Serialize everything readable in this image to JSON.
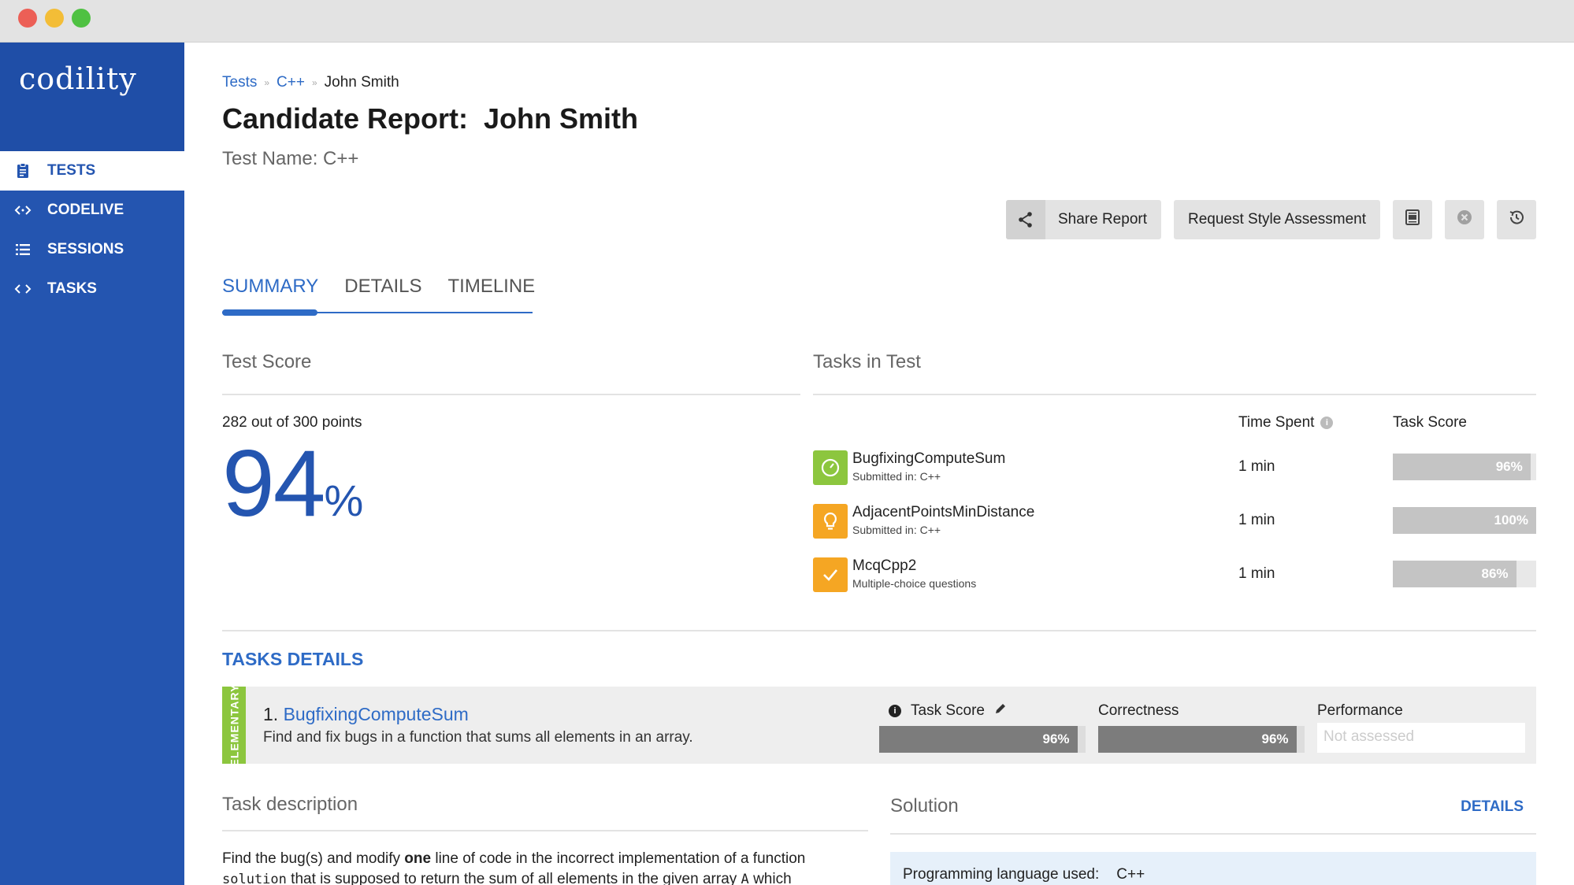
{
  "window": {
    "controls": [
      "close",
      "minimize",
      "maximize"
    ]
  },
  "sidebar": {
    "logo": "codility",
    "items": [
      {
        "label": "TESTS",
        "icon": "clipboard-icon",
        "active": true
      },
      {
        "label": "CODELIVE",
        "icon": "code-brackets-icon",
        "active": false
      },
      {
        "label": "SESSIONS",
        "icon": "list-icon",
        "active": false
      },
      {
        "label": "TASKS",
        "icon": "code-brackets-icon",
        "active": false
      }
    ]
  },
  "breadcrumb": {
    "items": [
      "Tests",
      "C++",
      "John Smith"
    ],
    "separator": "»"
  },
  "page": {
    "title": "Candidate Report:  John Smith",
    "subtitle": "Test Name: C++"
  },
  "toolbar": {
    "share_label": "Share Report",
    "style_label": "Request Style Assessment",
    "icons": [
      "share-icon",
      "pdf-icon",
      "cancel-icon",
      "history-icon"
    ]
  },
  "tabs": [
    {
      "label": "SUMMARY",
      "active": true
    },
    {
      "label": "DETAILS",
      "active": false
    },
    {
      "label": "TIMELINE",
      "active": false
    }
  ],
  "test_score": {
    "heading": "Test Score",
    "points": "282 out of 300 points",
    "value": "94",
    "unit": "%"
  },
  "tasks_in_test": {
    "heading": "Tasks in Test",
    "col_time": "Time Spent",
    "col_score": "Task Score",
    "tasks": [
      {
        "name": "BugfixingComputeSum",
        "sub": "Submitted in: C++",
        "time": "1 min",
        "score": 96,
        "score_label": "96%",
        "icon": "timer-icon",
        "icon_color": "#8cc63e"
      },
      {
        "name": "AdjacentPointsMinDistance",
        "sub": "Submitted in: C++",
        "time": "1 min",
        "score": 100,
        "score_label": "100%",
        "icon": "lightbulb-icon",
        "icon_color": "#f5a623"
      },
      {
        "name": "McqCpp2",
        "sub": "Multiple-choice questions",
        "time": "1 min",
        "score": 86,
        "score_label": "86%",
        "icon": "checkmark-icon",
        "icon_color": "#f5a623"
      }
    ]
  },
  "tasks_details": {
    "heading": "TASKS DETAILS",
    "card": {
      "difficulty": "ELEMENTARY",
      "number": "1.",
      "name": "BugfixingComputeSum",
      "description": "Find and fix bugs in a function that sums all elements in an array.",
      "task_score_label": "Task Score",
      "task_score": 96,
      "task_score_text": "96%",
      "correctness_label": "Correctness",
      "correctness": 96,
      "correctness_text": "96%",
      "performance_label": "Performance",
      "performance_text": "Not assessed"
    }
  },
  "task_description": {
    "heading": "Task description",
    "line1_pre": "Find the bug(s) and modify ",
    "line1_bold": "one",
    "line1_post": " line of code in the incorrect implementation of a function",
    "line2_code": "solution",
    "line2_post": " that is supposed to return the sum of all elements in the given array ",
    "line2_code2": "A",
    "line2_end": " which"
  },
  "solution": {
    "heading": "Solution",
    "details_link": "DETAILS",
    "lang_label": "Programming language used:",
    "lang_value": "C++"
  },
  "colors": {
    "sidebar": "#2455b0",
    "accent": "#2e6bc6",
    "green": "#8cc63e",
    "orange": "#f5a623"
  }
}
